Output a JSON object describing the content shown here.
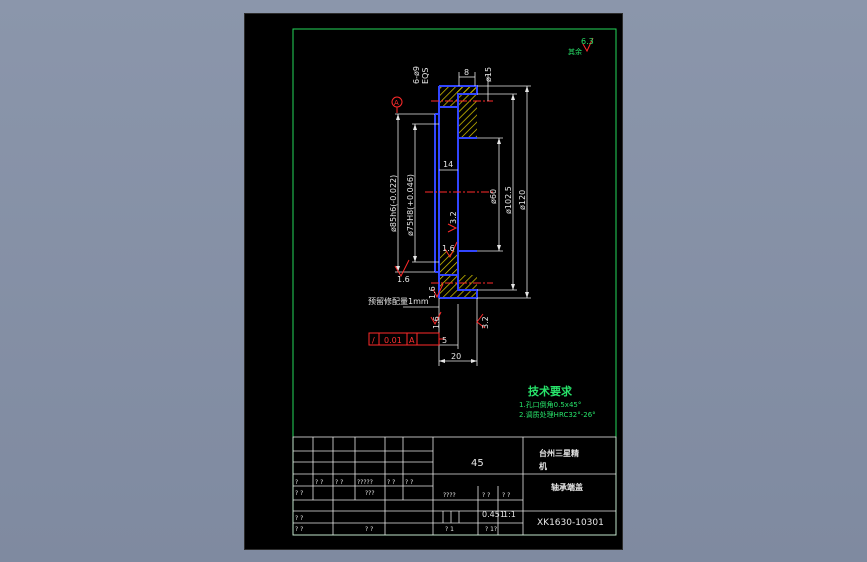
{
  "dimensions": {
    "holes": "6-ø9",
    "eqs": "EQS",
    "width_8": "8",
    "d15": "ø15",
    "d120": "ø120",
    "d102": "ø102.5",
    "d60": "ø60",
    "w14": "14",
    "d85": "ø85h6(-0.022)",
    "d75": "ø75H8(+0.046)",
    "r32a": "3.2",
    "r16a": "1.6",
    "r16b": "1.6",
    "r16c": "1.6",
    "r16d": "1.6",
    "r32b": "3.2",
    "w5": "5",
    "w20": "20",
    "note_fit": "预留修配量1mm",
    "datum": "A"
  },
  "tolerance": {
    "symbol": "/",
    "value": "0.01",
    "datum": "A"
  },
  "roughness_note": {
    "value": "6.3",
    "label": "其余"
  },
  "tech": {
    "title": "技术要求",
    "line1": "1.孔口倒角0.5x45°",
    "line2": "2.调质处理HRC32°-26°"
  },
  "title_block": {
    "material": "45",
    "company_line1": "台州三星精",
    "company_line2": "机",
    "part_name": "轴承端盖",
    "scale": "1:1",
    "weight": "0.451",
    "drawing_no": "XK1630-10301",
    "q": "?",
    "qq": "? ?",
    "qqq": "???",
    "qqqq": "????",
    "qqqqq": "?????",
    "q1": "? 1",
    "q1s": "? 1?"
  }
}
